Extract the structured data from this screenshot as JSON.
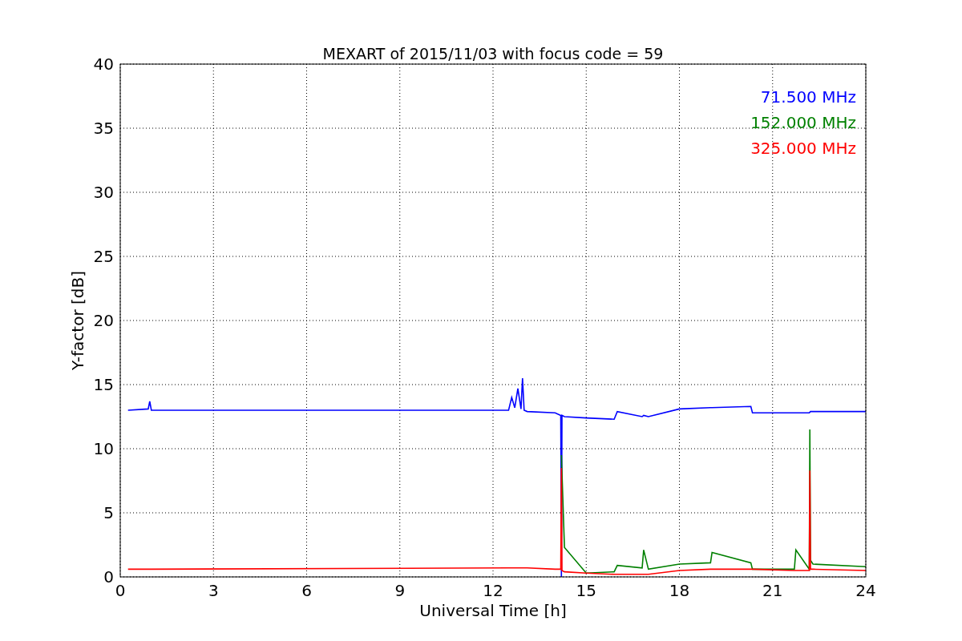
{
  "chart_data": {
    "type": "line",
    "title": "MEXART of 2015/11/03 with focus code = 59",
    "xlabel": "Universal Time [h]",
    "ylabel": "Y-factor [dB]",
    "xlim": [
      0,
      24
    ],
    "ylim": [
      0,
      40
    ],
    "xticks": [
      0,
      3,
      6,
      9,
      12,
      15,
      18,
      21,
      24
    ],
    "yticks": [
      0,
      5,
      10,
      15,
      20,
      25,
      30,
      35,
      40
    ],
    "grid": true,
    "x": [
      0.25,
      0.9,
      0.95,
      1.0,
      12.5,
      12.6,
      12.7,
      12.8,
      12.9,
      12.95,
      13.0,
      13.1,
      14.0,
      14.18,
      14.2,
      14.22,
      14.3,
      15,
      15.9,
      16,
      16.8,
      16.85,
      17,
      18,
      19,
      19.05,
      20.3,
      20.35,
      21.7,
      21.75,
      22.18,
      22.2,
      22.22,
      22.3,
      24
    ],
    "series": [
      {
        "name": "71.500 MHz",
        "color": "#0000ff",
        "values": [
          13.0,
          13.1,
          13.7,
          13.0,
          13.0,
          14.0,
          13.2,
          14.7,
          13.1,
          15.5,
          13.0,
          12.9,
          12.8,
          12.6,
          0,
          12.6,
          12.5,
          12.4,
          12.3,
          12.9,
          12.5,
          12.6,
          12.5,
          13.1,
          13.2,
          13.2,
          13.3,
          12.8,
          12.8,
          12.8,
          12.8,
          null,
          12.9,
          12.9,
          12.9
        ]
      },
      {
        "name": "152.000 MHz",
        "color": "#008000",
        "values": [
          null,
          null,
          null,
          null,
          null,
          null,
          null,
          null,
          null,
          null,
          null,
          null,
          null,
          null,
          9.5,
          null,
          2.3,
          0.3,
          0.4,
          0.9,
          0.7,
          2.1,
          0.6,
          1.0,
          1.1,
          1.9,
          1.1,
          0.6,
          0.6,
          2.1,
          0.6,
          11.5,
          1.3,
          1.0,
          0.8
        ]
      },
      {
        "name": "325.000 MHz",
        "color": "#ff0000",
        "values": [
          0.6,
          0.6,
          0.6,
          0.6,
          0.7,
          0.7,
          0.7,
          0.7,
          0.7,
          0.7,
          0.7,
          0.7,
          0.6,
          0.6,
          8.5,
          0.5,
          0.4,
          0.3,
          0.2,
          0.2,
          0.2,
          0.2,
          0.2,
          0.5,
          0.6,
          0.6,
          0.6,
          0.6,
          0.5,
          0.5,
          0.5,
          8.3,
          0.6,
          0.6,
          0.5
        ]
      }
    ]
  }
}
